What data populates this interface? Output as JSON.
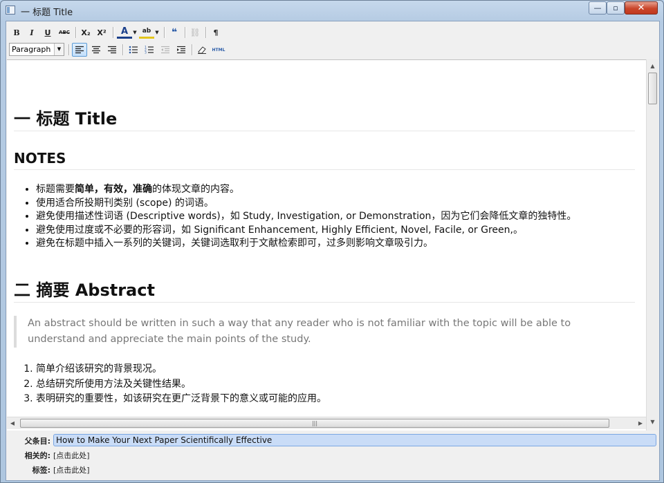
{
  "window": {
    "title": "一 标题 Title",
    "minimize": "—",
    "maximize": "▫",
    "close": "✕"
  },
  "toolbar": {
    "bold": "B",
    "italic": "I",
    "underline": "U",
    "strikethrough": "ABC",
    "subscript": "X₂",
    "superscript": "X²",
    "font_color": "A",
    "highlight": "ab",
    "blockquote": "❝",
    "link": "⛓",
    "pilcrow": "¶",
    "format_select": "Paragraph",
    "html": "HTML"
  },
  "document": {
    "h1_title": "一 标题 Title",
    "h2_notes": "NOTES",
    "notes": [
      {
        "pre": "标题需要",
        "bold": "简单，有效，准确",
        "post": "的体现文章的内容。"
      },
      {
        "pre": "使用适合所投期刊类别 (scope) 的词语。",
        "bold": "",
        "post": ""
      },
      {
        "pre": "避免使用描述性词语 (Descriptive words)，如 Study, Investigation, or Demonstration，因为它们会降低文章的独特性。",
        "bold": "",
        "post": ""
      },
      {
        "pre": "避免使用过度或不必要的形容词，如 Significant Enhancement, Highly Efficient, Novel, Facile, or Green,。",
        "bold": "",
        "post": ""
      },
      {
        "pre": "避免在标题中插入一系列的关键词，关键词选取利于文献检索即可，过多则影响文章吸引力。",
        "bold": "",
        "post": ""
      }
    ],
    "h1_abstract": "二 摘要 Abstract",
    "abstract_quote": "An abstract should be written in such a way that any reader who is not familiar with the topic will be able to understand and appreciate the main points of the study.",
    "points": [
      "简单介绍该研究的背景现况。",
      "总结研究所使用方法及关键性结果。",
      "表明研究的重要性，如该研究在更广泛背景下的意义或可能的应用。"
    ]
  },
  "properties": {
    "parent_label": "父条目:",
    "parent_value": "How to Make Your Next Paper Scientifically Effective",
    "related_label": "相关的:",
    "related_value": "[点击此处]",
    "tags_label": "标签:",
    "tags_value": "[点击此处]"
  }
}
